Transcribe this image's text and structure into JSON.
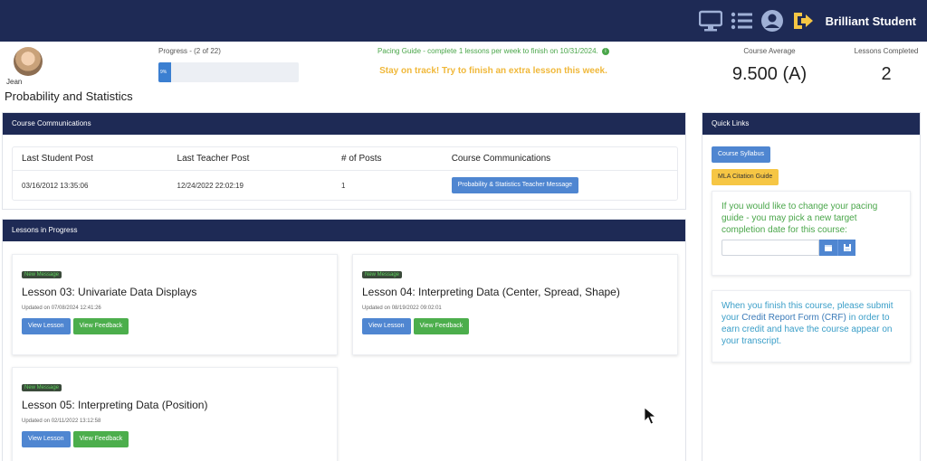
{
  "header": {
    "brand": "Brilliant Student",
    "icons": [
      "monitor-icon",
      "list-icon",
      "user-icon",
      "logout-icon"
    ]
  },
  "student": {
    "name": "Jean",
    "course_title": "Probability and Statistics"
  },
  "progress": {
    "label": "Progress - (2 of 22)",
    "percent_text": "9%",
    "percent": 9
  },
  "pacing": {
    "guide": "Pacing Guide - complete 1 lessons per week to finish on 10/31/2024.",
    "info_glyph": "i",
    "warning": "Stay on track! Try to finish an extra lesson this week."
  },
  "stats": {
    "average_label": "Course Average",
    "average_value": "9.500 (A)",
    "completed_label": "Lessons Completed",
    "completed_value": "2"
  },
  "communications": {
    "panel_title": "Course Communications",
    "headers": [
      "Last Student Post",
      "Last Teacher Post",
      "# of Posts",
      "Course Communications"
    ],
    "row": {
      "last_student_post": "03/16/2012 13:35:06",
      "last_teacher_post": "12/24/2022 22:02:19",
      "posts": "1",
      "message_button": "Probability & Statistics Teacher Message"
    }
  },
  "lessons": {
    "panel_title": "Lessons in Progress",
    "items": [
      {
        "badge": "New Message",
        "title": "Lesson 03: Univariate Data Displays",
        "updated": "Updated on 07/08/2024 12:41:26",
        "view_label": "View Lesson",
        "feedback_label": "View Feedback"
      },
      {
        "badge": "New Message",
        "title": "Lesson 04: Interpreting Data (Center, Spread, Shape)",
        "updated": "Updated on 08/19/2022 09:02:01",
        "view_label": "View Lesson",
        "feedback_label": "View Feedback"
      },
      {
        "badge": "New Message",
        "title": "Lesson 05: Interpreting Data (Position)",
        "updated": "Updated on 02/11/2022 13:12:58",
        "view_label": "View Lesson",
        "feedback_label": "View Feedback"
      }
    ]
  },
  "quick_links": {
    "panel_title": "Quick Links",
    "syllabus_button": "Course Syllabus",
    "citation_button": "MLA Citation Guide",
    "pacing_change_text": "If you would like to change your pacing guide - you may pick a new target completion date for this course:",
    "date_value": "",
    "crf_text_before": "When you finish this course, please submit your ",
    "crf_link": "Credit Report Form (CRF)",
    "crf_text_after": " in order to earn credit and have the course appear on your transcript."
  },
  "colors": {
    "navy": "#1e2a55",
    "blue_button": "#4f86d1",
    "green_button": "#4cae4c",
    "yellow_button": "#f6c644",
    "warning_text": "#f0b83a",
    "pacing_text": "#4aa64a"
  }
}
